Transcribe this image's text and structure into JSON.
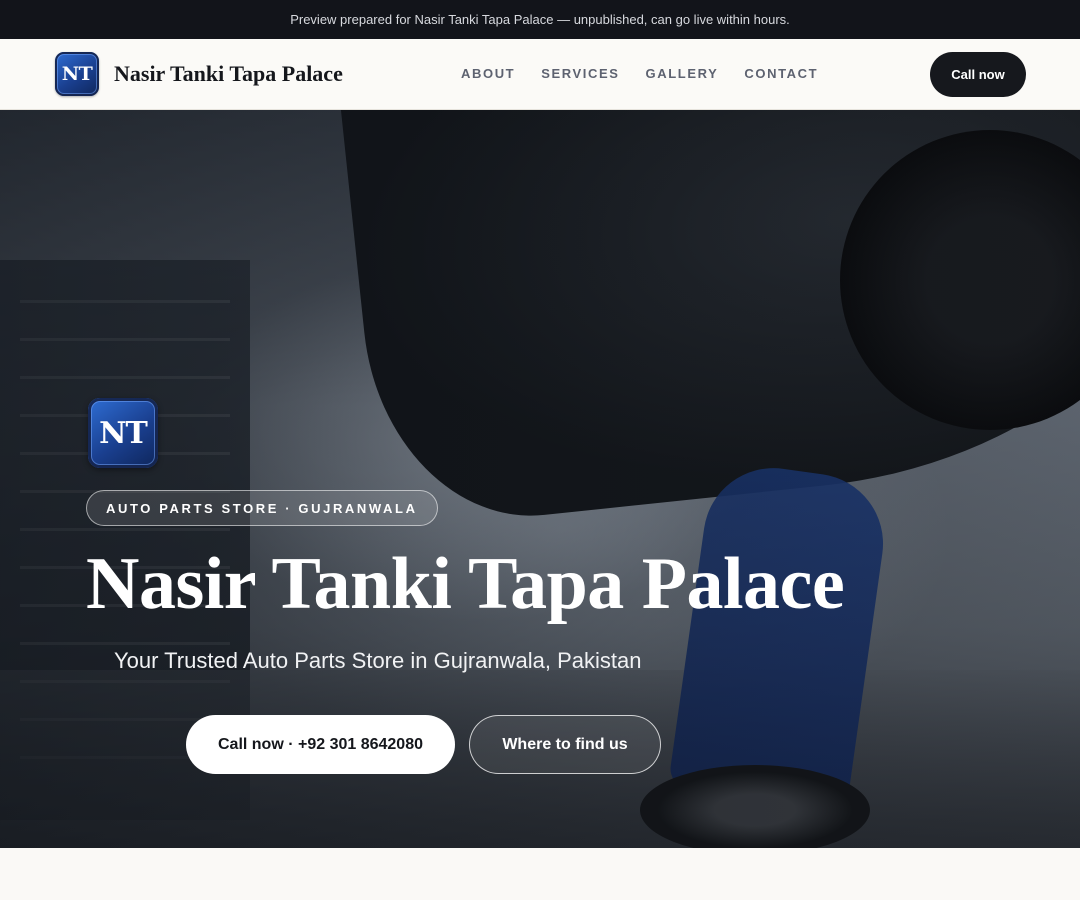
{
  "banner": {
    "text": "Preview prepared for Nasir Tanki Tapa Palace — unpublished, can go live within hours."
  },
  "header": {
    "logo_text": "NT",
    "brand_name": "Nasir Tanki Tapa Palace",
    "nav": [
      {
        "label": "ABOUT"
      },
      {
        "label": "SERVICES"
      },
      {
        "label": "GALLERY"
      },
      {
        "label": "CONTACT"
      }
    ],
    "cta_label": "Call now"
  },
  "hero": {
    "logo_text": "NT",
    "tagline": "AUTO PARTS STORE · GUJRANWALA",
    "title": "Nasir Tanki Tapa Palace",
    "subtitle": "Your Trusted Auto Parts Store in Gujranwala, Pakistan",
    "primary_button": "Call now · +92 301 8642080",
    "secondary_button": "Where to find us"
  },
  "colors": {
    "banner_bg": "#12141a",
    "accent_dark": "#16181d",
    "logo_blue": "#1a3f8f"
  }
}
